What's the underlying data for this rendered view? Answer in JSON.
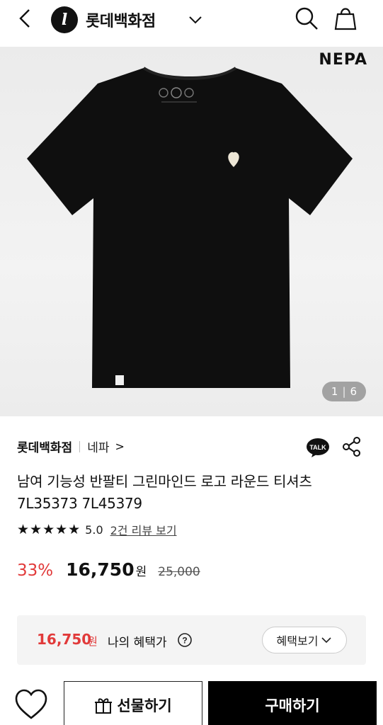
{
  "header": {
    "title": "롯데백화점",
    "logo_letter": "l"
  },
  "product_image": {
    "brand_logo": "NEPA",
    "counter_current": "1",
    "counter_separator": "|",
    "counter_total": "6",
    "shirt_color": "#0f0f0f"
  },
  "info": {
    "store": "롯데백화점",
    "brand": "네파",
    "brand_arrow": ">",
    "talk_label": "TALK",
    "title": "남여 기능성 반팔티 그린마인드 로고 라운드 티셔츠 7L35373 7L45379",
    "stars": "★★★★★",
    "score": "5.0",
    "reviews": "2건 리뷰 보기",
    "discount": "33%",
    "price": "16,750",
    "won": "원",
    "original_price": "25,000"
  },
  "benefit": {
    "price": "16,750",
    "won": "원",
    "label": "나의 혜택가",
    "button": "혜택보기"
  },
  "bottom_bar": {
    "gift": "선물하기",
    "buy": "구매하기"
  },
  "colors": {
    "accent_red": "#e13a3a",
    "black": "#000000"
  }
}
